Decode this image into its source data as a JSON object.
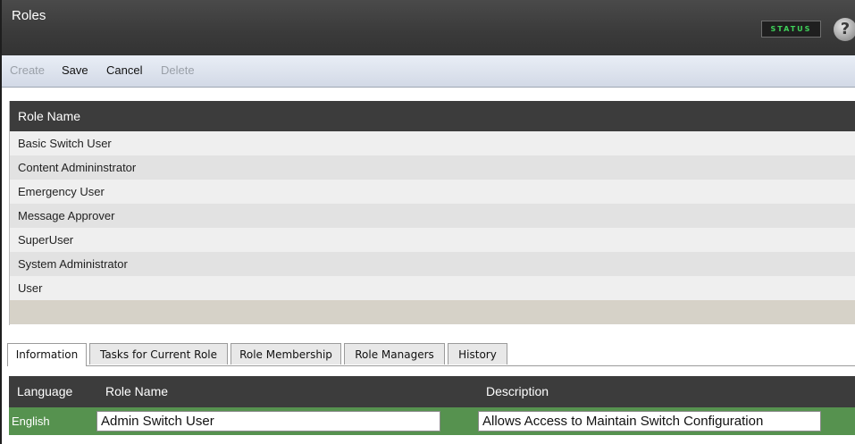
{
  "app": {
    "title": "Roles",
    "status_label": "STATUS",
    "help_glyph": "?"
  },
  "toolbar": {
    "create_label": "Create",
    "save_label": "Save",
    "cancel_label": "Cancel",
    "delete_label": "Delete"
  },
  "roles_grid": {
    "column_header": "Role Name",
    "rows": [
      "Basic Switch User",
      "Content Admininstrator",
      "Emergency User",
      "Message Approver",
      "SuperUser",
      "System Administrator",
      "User"
    ]
  },
  "tabs": [
    {
      "label": "Information",
      "active": true
    },
    {
      "label": "Tasks for Current Role",
      "active": false
    },
    {
      "label": "Role Membership",
      "active": false
    },
    {
      "label": "Role Managers",
      "active": false
    },
    {
      "label": "History",
      "active": false
    }
  ],
  "detail": {
    "headers": {
      "language": "Language",
      "role_name": "Role Name",
      "description": "Description"
    },
    "row": {
      "language": "English",
      "role_name": "Admin Switch User",
      "description": "Allows Access to Maintain Switch Configuration"
    }
  },
  "colors": {
    "titlebar": "#3a3a3a",
    "status_text": "#3fd25a",
    "selected_row": "#56924f"
  }
}
